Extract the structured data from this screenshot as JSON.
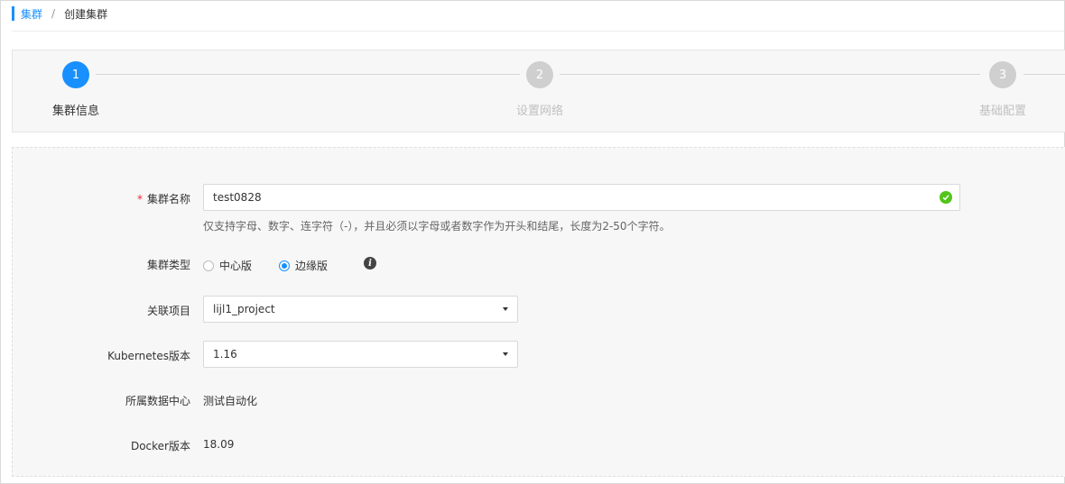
{
  "breadcrumb": {
    "parent": "集群",
    "separator": "/",
    "current": "创建集群"
  },
  "steps": [
    {
      "number": "1",
      "label": "集群信息",
      "state": "active"
    },
    {
      "number": "2",
      "label": "设置网络",
      "state": "inactive"
    },
    {
      "number": "3",
      "label": "基础配置",
      "state": "inactive"
    }
  ],
  "form": {
    "cluster_name": {
      "label": "集群名称",
      "required_mark": "*",
      "value": "test0828",
      "valid": true,
      "hint": "仅支持字母、数字、连字符（-），并且必须以字母或者数字作为开头和结尾，长度为2-50个字符。"
    },
    "cluster_type": {
      "label": "集群类型",
      "options": [
        {
          "label": "中心版",
          "checked": false
        },
        {
          "label": "边缘版",
          "checked": true
        }
      ],
      "info_icon": "info-icon"
    },
    "project": {
      "label": "关联项目",
      "value": "lijl1_project"
    },
    "kubernetes_version": {
      "label": "Kubernetes版本",
      "value": "1.16"
    },
    "datacenter": {
      "label": "所属数据中心",
      "value": "测试自动化"
    },
    "docker_version": {
      "label": "Docker版本",
      "value": "18.09"
    }
  },
  "colors": {
    "primary": "#1890ff",
    "success": "#52c41a",
    "required": "#f5222d",
    "inactive_step": "#cfcfcf"
  }
}
